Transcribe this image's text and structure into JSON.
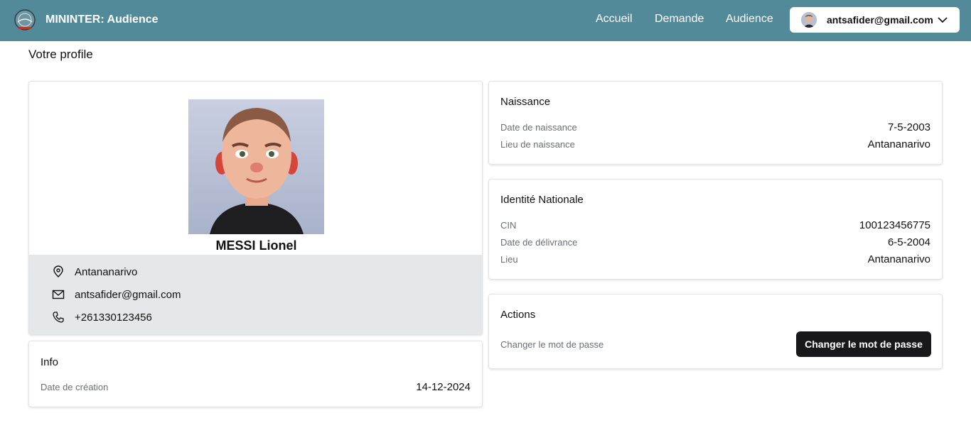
{
  "navbar": {
    "brand": "MININTER: Audience",
    "links": [
      "Accueil",
      "Demande",
      "Audience"
    ],
    "user_email": "antsafider@gmail.com",
    "user_menu_icon": "chevron-down-icon",
    "bg_color": "#528a9a"
  },
  "page": {
    "title": "Votre profile"
  },
  "profile": {
    "name": "MESSI Lionel",
    "location": "Antananarivo",
    "email": "antsafider@gmail.com",
    "phone": "+261330123456"
  },
  "info": {
    "title": "Info",
    "creation_label": "Date de création",
    "creation_value": "14-12-2024"
  },
  "naissance": {
    "title": "Naissance",
    "date_label": "Date de naissance",
    "date_value": "7-5-2003",
    "lieu_label": "Lieu de naissance",
    "lieu_value": "Antananarivo"
  },
  "identite": {
    "title": "Identité Nationale",
    "cin_label": "CIN",
    "cin_value": "100123456775",
    "delivrance_label": "Date de délivrance",
    "delivrance_value": "6-5-2004",
    "lieu_label": "Lieu",
    "lieu_value": "Antananarivo"
  },
  "actions": {
    "title": "Actions",
    "change_label": "Changer le mot de passe",
    "change_button": "Changer le mot de passe"
  }
}
